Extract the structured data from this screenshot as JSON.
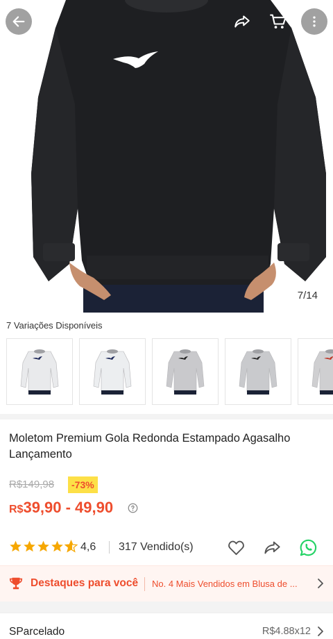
{
  "hero": {
    "image_counter": "7/14",
    "icons": [
      "back-arrow-icon",
      "share-icon",
      "cart-icon",
      "more-vertical-icon"
    ]
  },
  "variations": {
    "title": "7 Variações Disponíveis",
    "thumbs": [
      {
        "color": "#e9eaec",
        "logo": "#1f2a5a"
      },
      {
        "color": "#eceef0",
        "logo": "#1f2a5a"
      },
      {
        "color": "#c9c9cc",
        "logo": "#222222"
      },
      {
        "color": "#c9cacd",
        "logo": "#2a2a2a"
      },
      {
        "color": "#cfcfd1",
        "logo": "#c0392b"
      }
    ]
  },
  "product": {
    "title": "Moletom Premium Gola Redonda Estampado Agasalho Lançamento",
    "old_price": "R$149,98",
    "discount": "-73%",
    "price_currency": "R$",
    "price_range": "39,90 - 49,90",
    "rating": "4,6",
    "sold": "317 Vendido(s)"
  },
  "highlight": {
    "title": "Destaques para você",
    "text": "No. 4 Mais Vendidos em Blusa de ..."
  },
  "installments": {
    "label": "SParcelado",
    "value": "R$4.88x12"
  },
  "colors": {
    "accent": "#ee4d2d",
    "star": "#f6a700",
    "discount_bg": "#fde047",
    "whatsapp": "#25d366"
  }
}
